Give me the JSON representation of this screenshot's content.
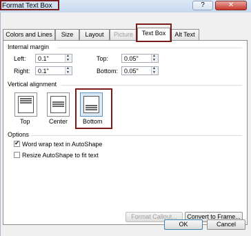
{
  "window": {
    "title": "Format Text Box",
    "help_glyph": "?",
    "close_glyph": "✕"
  },
  "tabs": [
    {
      "label": "Colors and Lines",
      "state": "normal"
    },
    {
      "label": "Size",
      "state": "normal"
    },
    {
      "label": "Layout",
      "state": "normal"
    },
    {
      "label": "Picture",
      "state": "disabled"
    },
    {
      "label": "Text Box",
      "state": "active"
    },
    {
      "label": "Alt Text",
      "state": "normal"
    }
  ],
  "internal_margin": {
    "heading": "Internal margin",
    "left_label": "Left:",
    "left_value": "0.1\"",
    "right_label": "Right:",
    "right_value": "0.1\"",
    "top_label": "Top:",
    "top_value": "0.05\"",
    "bottom_label": "Bottom:",
    "bottom_value": "0.05\""
  },
  "vertical_alignment": {
    "heading": "Vertical alignment",
    "options": [
      {
        "label": "Top",
        "icon": "align-top-icon"
      },
      {
        "label": "Center",
        "icon": "align-center-icon"
      },
      {
        "label": "Bottom",
        "icon": "align-bottom-icon"
      }
    ],
    "selected": "Bottom"
  },
  "options": {
    "heading": "Options",
    "word_wrap_label": "Word wrap text in AutoShape",
    "word_wrap_checked": true,
    "resize_label": "Resize AutoShape to fit text",
    "resize_checked": false
  },
  "buttons": {
    "format_callout": "Format Callout...",
    "convert_to_frame": "Convert to Frame...",
    "ok": "OK",
    "cancel": "Cancel"
  },
  "colors": {
    "highlight": "#7b1a1a",
    "selected_fill": "#dbe9f7"
  }
}
